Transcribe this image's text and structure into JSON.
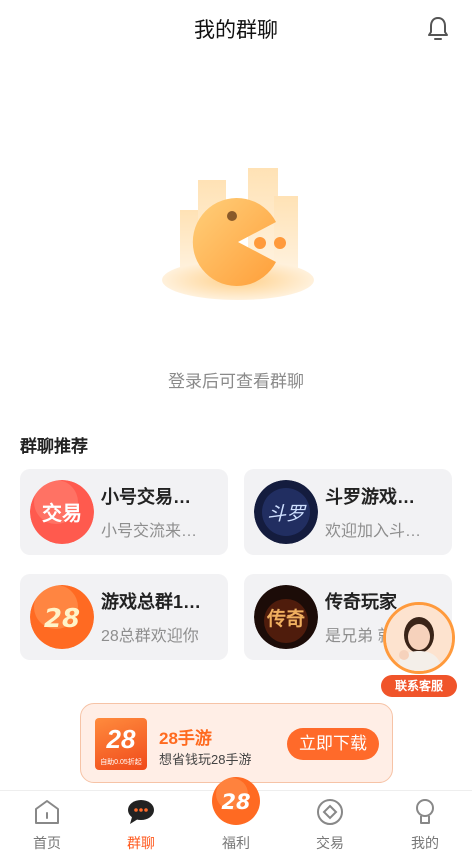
{
  "header": {
    "title": "我的群聊"
  },
  "empty_state": {
    "message": "登录后可查看群聊"
  },
  "section": {
    "title": "群聊推荐"
  },
  "groups": [
    {
      "name": "小号交易…",
      "desc": "小号交流来…",
      "avatar_text": "交易",
      "avatar_color": "#ff5a4e"
    },
    {
      "name": "斗罗游戏…",
      "desc": "欢迎加入斗…",
      "avatar_text": "斗罗",
      "avatar_color": "#1f2a5a"
    },
    {
      "name": "游戏总群1…",
      "desc": "28总群欢迎你",
      "avatar_text": "28",
      "avatar_color": "#ff7a30"
    },
    {
      "name": "传奇玩家",
      "desc": "是兄弟 就",
      "avatar_text": "传奇",
      "avatar_color": "#2a1410"
    }
  ],
  "service": {
    "label": "联系客服"
  },
  "banner": {
    "logo_number": "28",
    "logo_tag": "自助0.05折起",
    "app_name": "28手游",
    "slogan": "想省钱玩28手游",
    "download_label": "立即下载"
  },
  "tabbar": [
    {
      "label": "首页",
      "icon": "home-icon"
    },
    {
      "label": "群聊",
      "icon": "chat-icon",
      "active": true
    },
    {
      "label": "福利",
      "icon": "welfare-28-icon"
    },
    {
      "label": "交易",
      "icon": "trade-icon"
    },
    {
      "label": "我的",
      "icon": "profile-icon"
    }
  ],
  "colors": {
    "accent": "#ff5a1f",
    "card_bg": "#f2f2f4",
    "muted": "#8a8a8a"
  }
}
